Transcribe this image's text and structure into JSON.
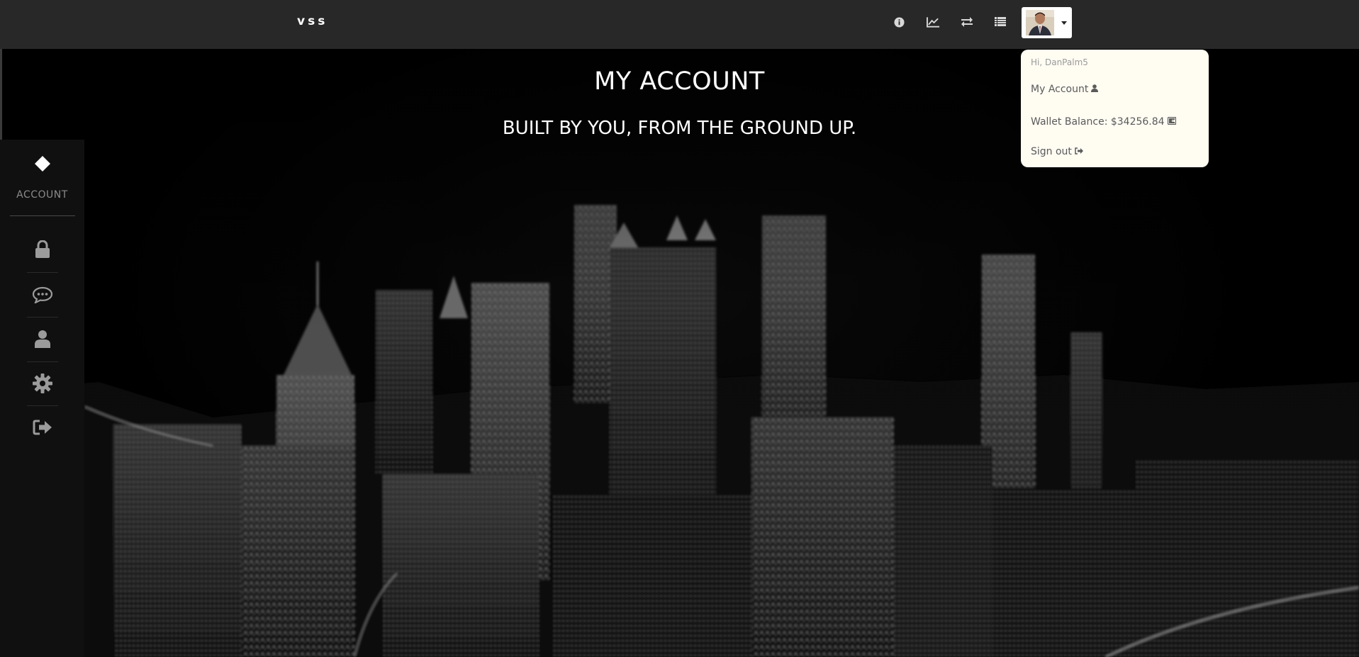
{
  "navbar": {
    "brand": "vss",
    "icons": [
      "info-icon",
      "line-chart-icon",
      "exchange-icon",
      "list-icon"
    ],
    "avatar_alt": "user avatar"
  },
  "dropdown": {
    "greeting": "Hi, DanPalm5",
    "my_account": "My Account",
    "wallet_balance": "Wallet Balance: $34256.84",
    "sign_out": "Sign out"
  },
  "header": {
    "title": "MY ACCOUNT",
    "subtitle": "BUILT BY YOU, FROM THE GROUND UP."
  },
  "sidebar": {
    "label": "ACCOUNT",
    "items": [
      "lock-icon",
      "chat-bubble-icon",
      "user-icon",
      "gear-icon",
      "sign-out-icon"
    ]
  },
  "colors": {
    "navbar_bg": "#282828",
    "sidebar_bg": "#101010",
    "dropdown_bg": "#fffcf2",
    "icon_gray": "#9b9b9b"
  }
}
